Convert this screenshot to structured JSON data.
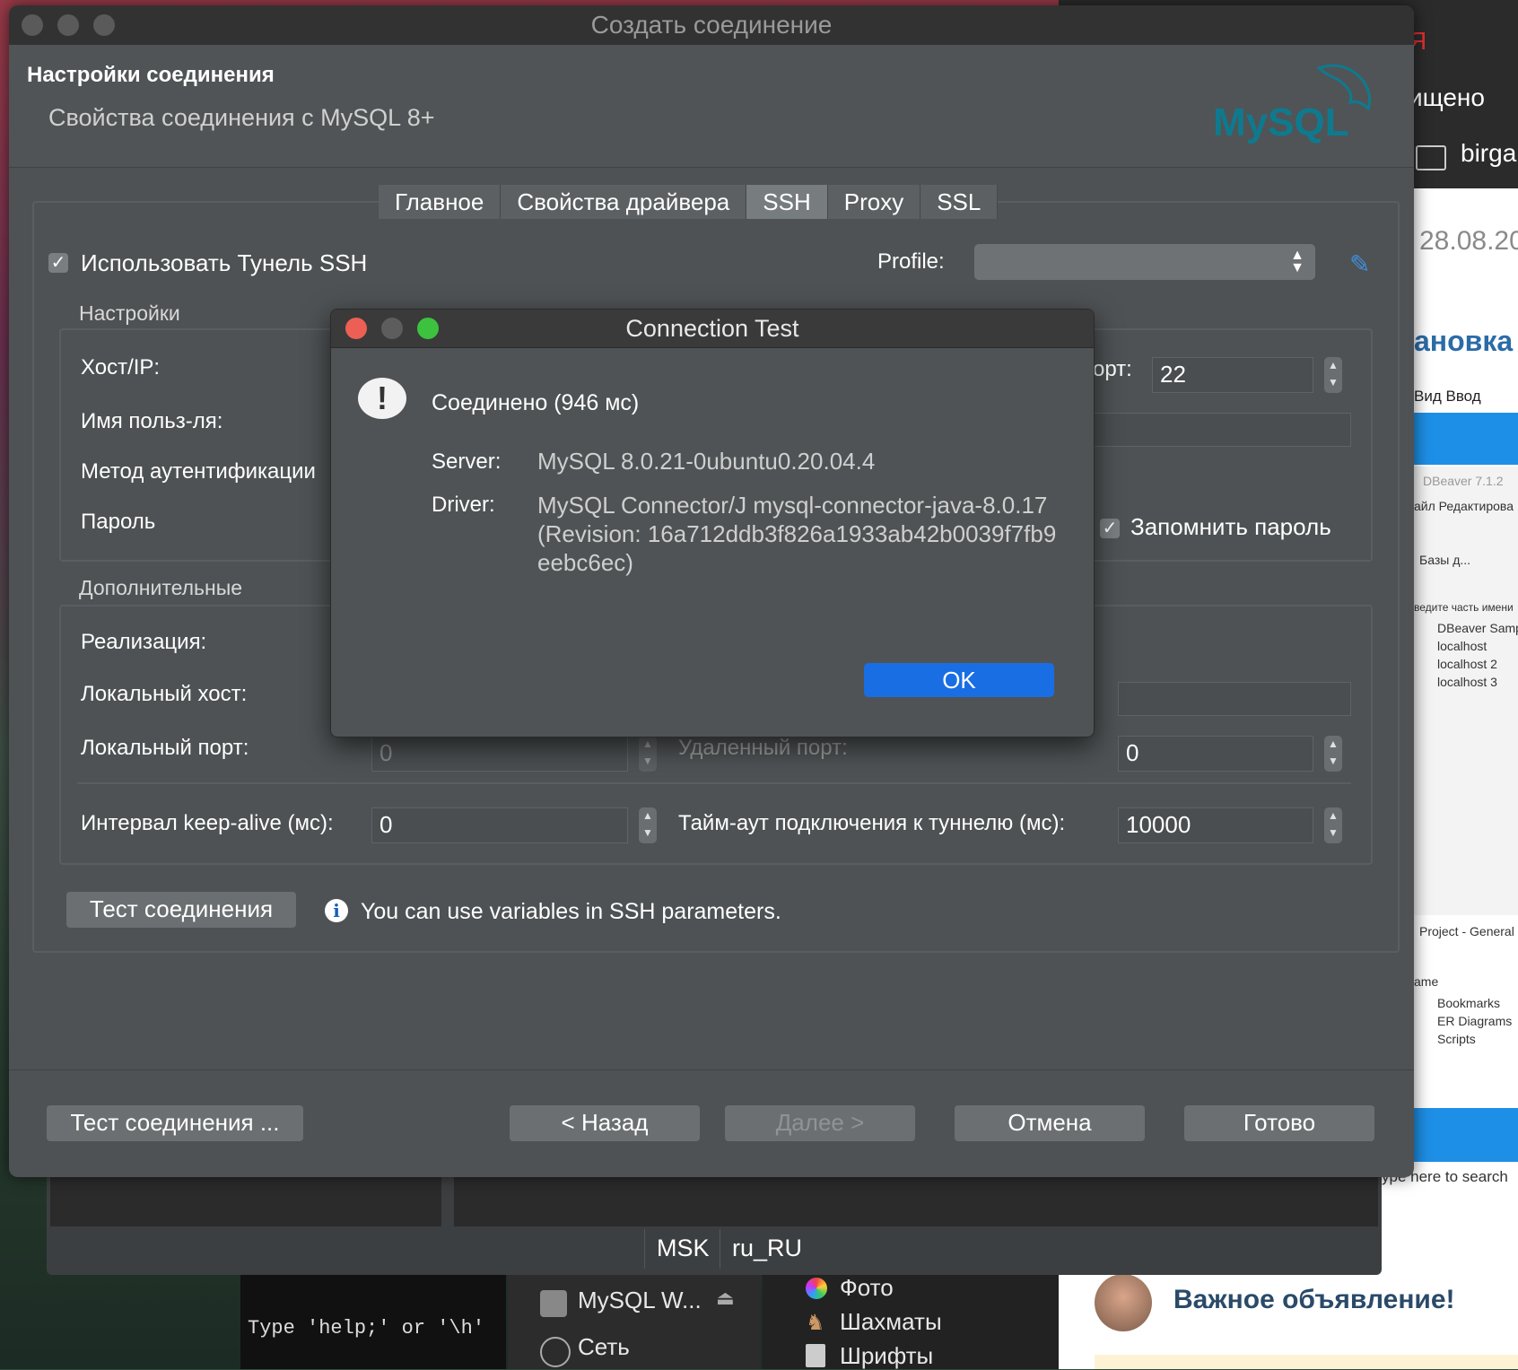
{
  "background": {
    "browser_partial_1": "ищено",
    "browser_folder": "birga",
    "browser_date": "28.08.20",
    "browser_heading": "ановка с",
    "browser_menu": "Вид   Ввод",
    "dbeaver_title": "DBeaver 7.1.2",
    "dbeaver_menu": "айл   Редактирова",
    "dbeaver_db": "Базы д...",
    "dbeaver_filter": "ведите часть имени",
    "dbeaver_items": [
      "DBeaver Sampl",
      "localhost",
      "localhost 2",
      "localhost 3"
    ],
    "dbeaver_project": "Project - General",
    "dbeaver_name": "ame",
    "dbeaver_folders": [
      "Bookmarks",
      "ER Diagrams",
      "Scripts"
    ],
    "search_hint": "ype here to search",
    "announce": "Важное объявление!",
    "terminal_line": "Type 'help;' or '\\h'",
    "sidebar_items": [
      "MySQL W...",
      "Сеть"
    ],
    "sidebar2_items": [
      "Фото",
      "Шахматы",
      "Шрифты"
    ],
    "status_tz": "MSK",
    "status_locale": "ru_RU"
  },
  "window": {
    "title": "Создать соединение",
    "section_title": "Настройки соединения",
    "subtitle": "Свойства соединения с MySQL 8+",
    "logo_text": "MySQL"
  },
  "tabs": [
    {
      "label": "Главное"
    },
    {
      "label": "Свойства драйвера"
    },
    {
      "label": "SSH"
    },
    {
      "label": "Proxy"
    },
    {
      "label": "SSL"
    }
  ],
  "active_tab": "SSH",
  "ssh": {
    "use_tunnel_label": "Использовать Тунель SSH",
    "use_tunnel_checked": true,
    "profile_label": "Profile:",
    "profile_value": "",
    "settings_group": "Настройки",
    "host_label": "Хост/IP:",
    "port_label_partial": "орт:",
    "port_value": "22",
    "user_label": "Имя польз-ля:",
    "auth_label": "Метод аутентификации",
    "password_label": "Пароль",
    "remember_label": "Запомнить пароль",
    "remember_checked": true,
    "extra_group": "Дополнительные",
    "impl_label": "Реализация:",
    "local_host_label": "Локальный хост:",
    "local_port_label": "Локальный порт:",
    "local_port_value": "0",
    "remote_port_label": "Удаленный порт:",
    "remote_port_value": "0",
    "keepalive_label": "Интервал keep-alive (мс):",
    "keepalive_value": "0",
    "timeout_label": "Тайм-аут подключения к туннелю (мс):",
    "timeout_value": "10000",
    "test_button": "Тест соединения",
    "info_text": "You can use variables in SSH parameters."
  },
  "footer": {
    "test_button": "Тест соединения ...",
    "back_button": "< Назад",
    "next_button": "Далее >",
    "cancel_button": "Отмена",
    "finish_button": "Готово"
  },
  "test_dialog": {
    "title": "Connection Test",
    "status": "Соединено (946 мс)",
    "server_label": "Server:",
    "server_value": "MySQL 8.0.21-0ubuntu0.20.04.4",
    "driver_label": "Driver:",
    "driver_value": "MySQL Connector/J mysql-connector-java-8.0.17 (Revision: 16a712ddb3f826a1933ab42b0039f7fb9eebc6ec)",
    "ok_button": "OK"
  },
  "colors": {
    "ok_blue": "#1a6ee4",
    "dialog_bg": "#4e5254",
    "mysql_blue": "#00758f",
    "mysql_orange": "#f29111",
    "close_red": "#ed5f55",
    "min_yellow": "#5d5d5d",
    "max_green": "#3cc23f"
  }
}
